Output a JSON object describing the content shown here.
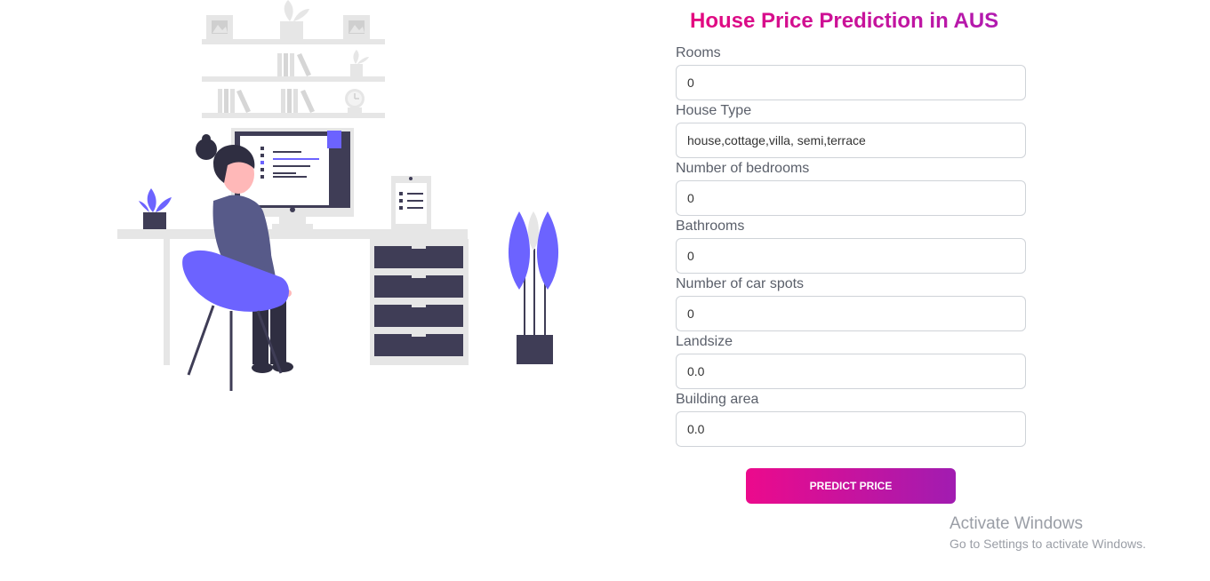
{
  "form": {
    "title": "House Price Prediction in AUS",
    "fields": [
      {
        "label": "Rooms",
        "value": "0"
      },
      {
        "label": "House Type",
        "value": "house,cottage,villa, semi,terrace"
      },
      {
        "label": "Number of bedrooms",
        "value": "0"
      },
      {
        "label": "Bathrooms",
        "value": "0"
      },
      {
        "label": "Number of car spots",
        "value": "0"
      },
      {
        "label": "Landsize",
        "value": "0.0"
      },
      {
        "label": "Building area",
        "value": "0.0"
      }
    ],
    "submit_label": "PREDICT PRICE"
  },
  "watermark": {
    "title": "Activate Windows",
    "subtitle": "Go to Settings to activate Windows."
  },
  "colors": {
    "accent_start": "#e4097f",
    "accent_end": "#a11cb1",
    "illustration_purple": "#6c63ff",
    "illustration_dark": "#3f3d56"
  },
  "illustration": {
    "icon": "person-at-desk-illustration"
  }
}
